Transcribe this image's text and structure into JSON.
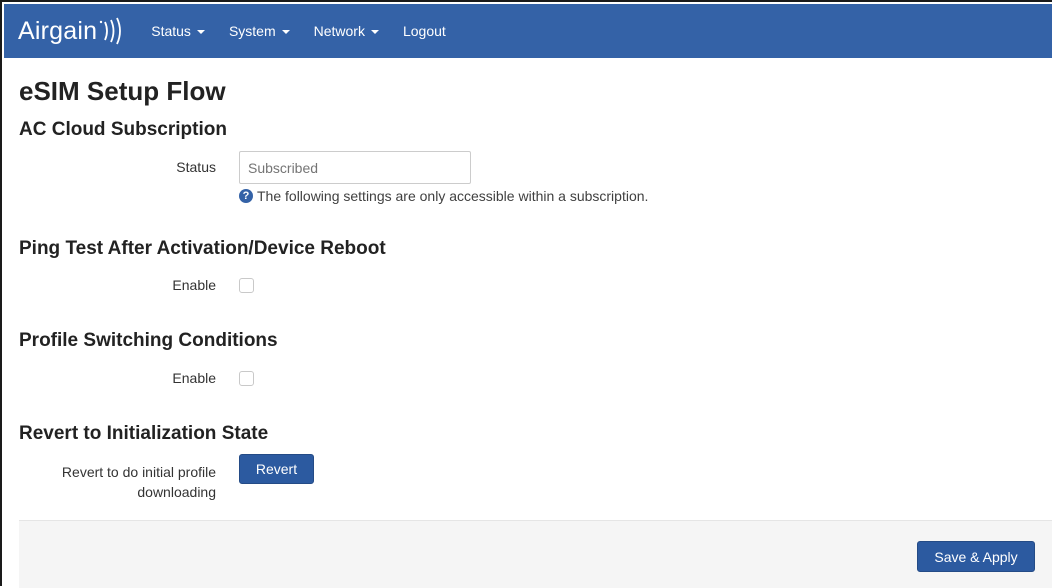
{
  "navbar": {
    "brand": "Airgain",
    "menu": [
      {
        "label": "Status",
        "has_dropdown": true
      },
      {
        "label": "System",
        "has_dropdown": true
      },
      {
        "label": "Network",
        "has_dropdown": true
      },
      {
        "label": "Logout",
        "has_dropdown": false
      }
    ]
  },
  "page": {
    "title": "eSIM Setup Flow"
  },
  "sections": {
    "subscription": {
      "title": "AC Cloud Subscription",
      "status_label": "Status",
      "status_placeholder": "Subscribed",
      "help_icon": "question-circle-icon",
      "help_text": "The following settings are only accessible within a subscription."
    },
    "ping_test": {
      "title": "Ping Test After Activation/Device Reboot",
      "enable_label": "Enable",
      "enabled": false
    },
    "profile_switching": {
      "title": "Profile Switching Conditions",
      "enable_label": "Enable",
      "enabled": false
    },
    "revert": {
      "title": "Revert to Initialization State",
      "label_line1": "Revert to do initial profile",
      "label_line2": "downloading",
      "button": "Revert"
    }
  },
  "footer": {
    "save_apply": "Save & Apply"
  },
  "colors": {
    "navbar_bg": "#3462a7",
    "primary_button": "#2c5aa0",
    "footer_bg": "#f5f5f5"
  }
}
